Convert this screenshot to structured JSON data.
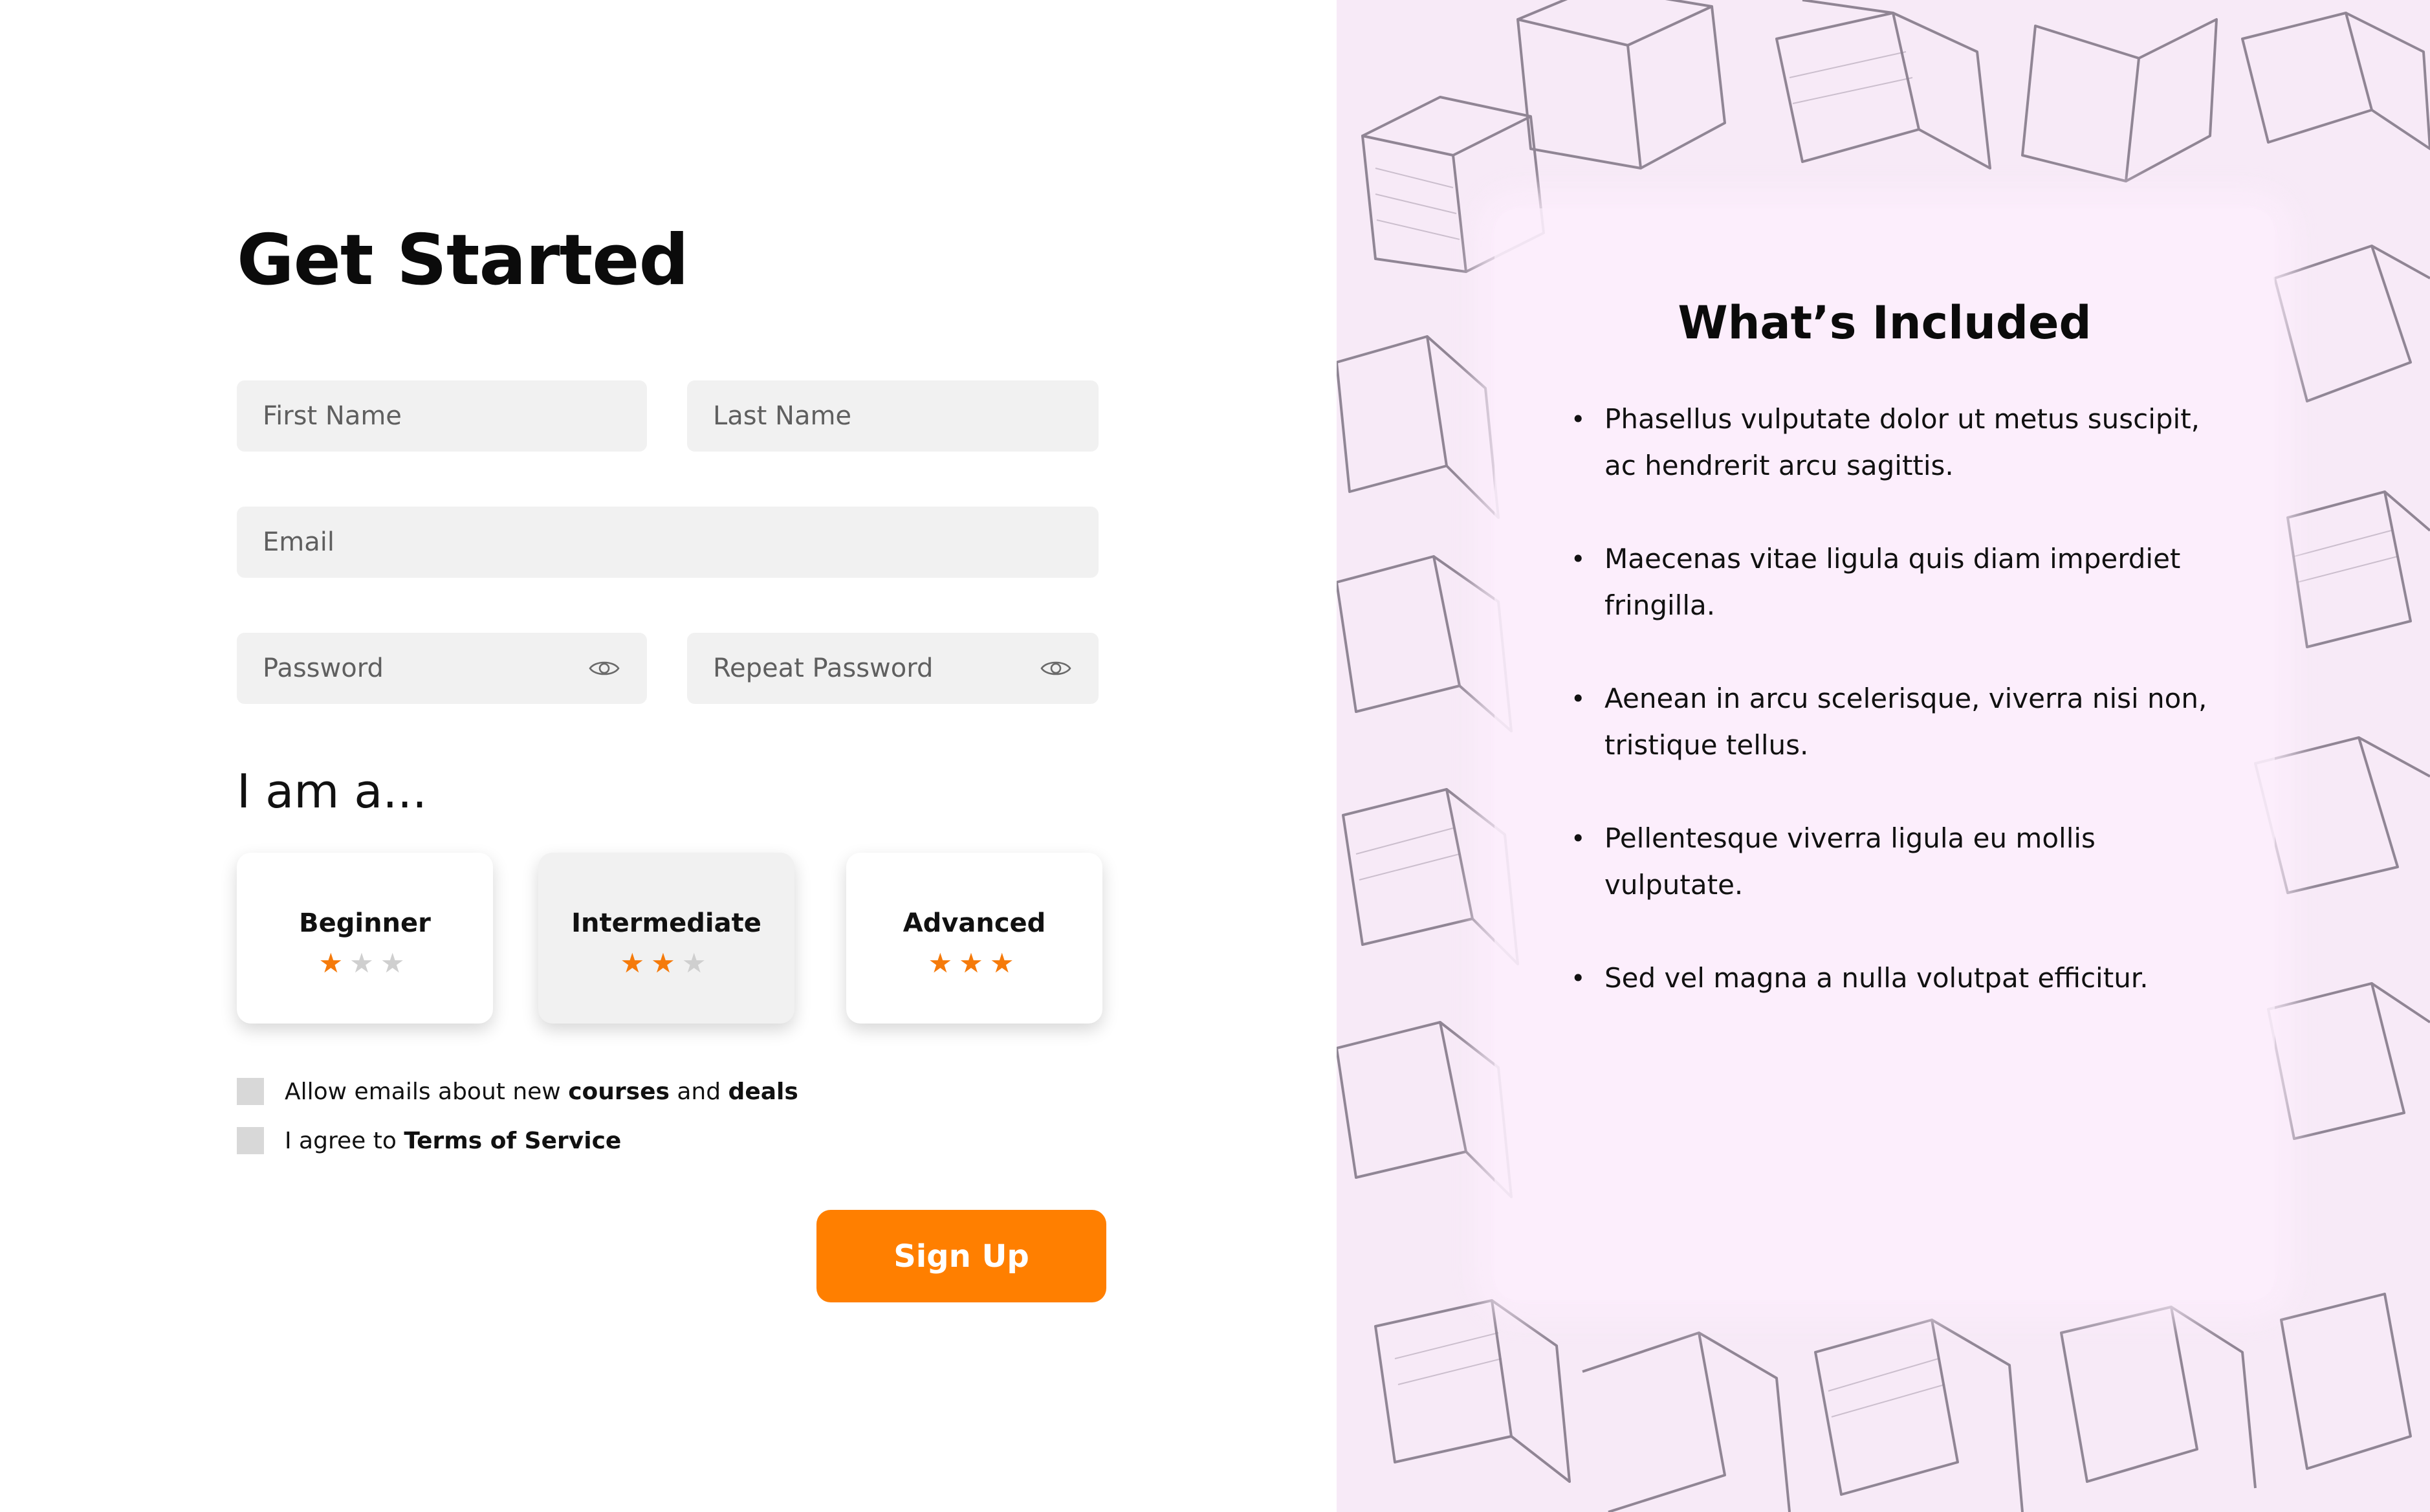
{
  "page_title": "Get Started",
  "form": {
    "first_name_placeholder": "First Name",
    "last_name_placeholder": "Last Name",
    "email_placeholder": "Email",
    "password_placeholder": "Password",
    "repeat_password_placeholder": "Repeat Password"
  },
  "level_section": {
    "label": "I am a...",
    "options": [
      {
        "label": "Beginner",
        "rating": 1,
        "max_rating": 3,
        "selected": false
      },
      {
        "label": "Intermediate",
        "rating": 2,
        "max_rating": 3,
        "selected": true
      },
      {
        "label": "Advanced",
        "rating": 3,
        "max_rating": 3,
        "selected": false
      }
    ]
  },
  "consent": {
    "emails": {
      "prefix": "Allow emails about new ",
      "bold1": "courses",
      "middle": " and ",
      "bold2": "deals"
    },
    "terms": {
      "prefix": "I agree to ",
      "bold": "Terms of Service"
    }
  },
  "signup_label": "Sign Up",
  "info": {
    "title": "What’s Included",
    "items": [
      "Phasellus vulputate dolor ut metus suscipit, ac hendrerit arcu sagittis.",
      "Maecenas vitae ligula quis diam imperdiet fringilla.",
      "Aenean in arcu scelerisque, viverra nisi non, tristique tellus.",
      "Pellentesque viverra ligula eu mollis vulputate.",
      "Sed vel magna a nulla volutpat efficitur."
    ]
  },
  "colors": {
    "accent": "#ff7f00",
    "star_active": "#f57a0a",
    "star_inactive": "#cfcfcf",
    "field_bg": "#f1f1f1",
    "panel_bg": "#f7eaf7"
  },
  "icons": {
    "password_toggle": "eye-icon",
    "background": "sketched-boxes-pattern"
  }
}
